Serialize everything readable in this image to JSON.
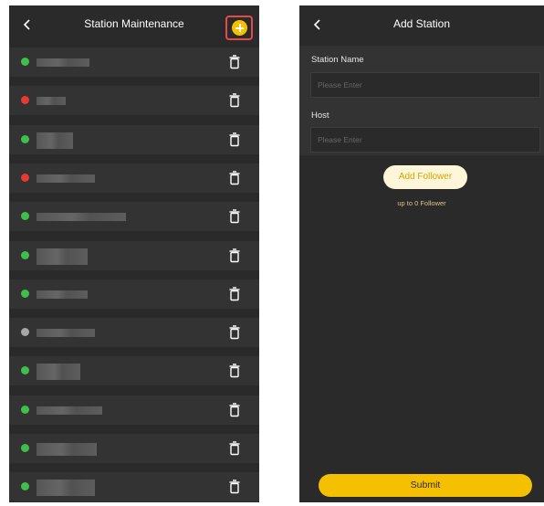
{
  "left": {
    "title": "Station Maintenance",
    "stations": [
      {
        "status_color": "#3fbf4a"
      },
      {
        "status_color": "#e83a2e"
      },
      {
        "status_color": "#3fbf4a"
      },
      {
        "status_color": "#e83a2e"
      },
      {
        "status_color": "#3fbf4a"
      },
      {
        "status_color": "#3fbf4a"
      },
      {
        "status_color": "#3fbf4a"
      },
      {
        "status_color": "#a6a6a6"
      },
      {
        "status_color": "#3fbf4a"
      },
      {
        "status_color": "#3fbf4a"
      },
      {
        "status_color": "#3fbf4a"
      },
      {
        "status_color": "#3fbf4a"
      }
    ]
  },
  "right": {
    "title": "Add Station",
    "station_name_label": "Station Name",
    "station_name_placeholder": "Please Enter",
    "host_label": "Host",
    "host_placeholder": "Please Enter",
    "add_follower_label": "Add Follower",
    "follower_hint": "up to 0 Follower",
    "submit_label": "Submit"
  },
  "colors": {
    "accent": "#f5c000",
    "highlight": "#e34b4b"
  }
}
